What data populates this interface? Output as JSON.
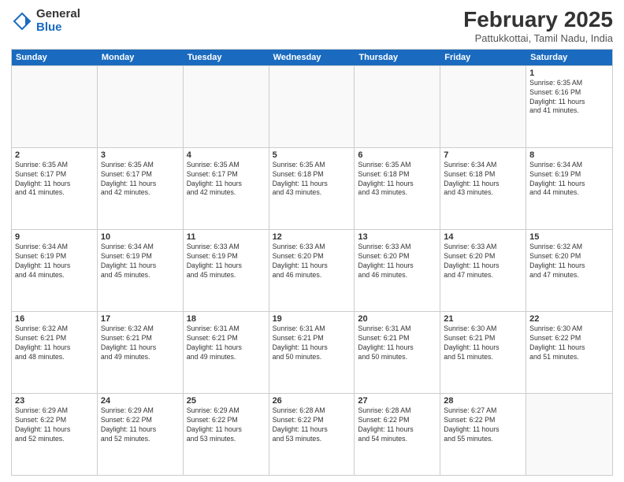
{
  "logo": {
    "general": "General",
    "blue": "Blue"
  },
  "title": "February 2025",
  "subtitle": "Pattukkottai, Tamil Nadu, India",
  "days": [
    "Sunday",
    "Monday",
    "Tuesday",
    "Wednesday",
    "Thursday",
    "Friday",
    "Saturday"
  ],
  "weeks": [
    [
      {
        "day": "",
        "info": ""
      },
      {
        "day": "",
        "info": ""
      },
      {
        "day": "",
        "info": ""
      },
      {
        "day": "",
        "info": ""
      },
      {
        "day": "",
        "info": ""
      },
      {
        "day": "",
        "info": ""
      },
      {
        "day": "1",
        "info": "Sunrise: 6:35 AM\nSunset: 6:16 PM\nDaylight: 11 hours\nand 41 minutes."
      }
    ],
    [
      {
        "day": "2",
        "info": "Sunrise: 6:35 AM\nSunset: 6:17 PM\nDaylight: 11 hours\nand 41 minutes."
      },
      {
        "day": "3",
        "info": "Sunrise: 6:35 AM\nSunset: 6:17 PM\nDaylight: 11 hours\nand 42 minutes."
      },
      {
        "day": "4",
        "info": "Sunrise: 6:35 AM\nSunset: 6:17 PM\nDaylight: 11 hours\nand 42 minutes."
      },
      {
        "day": "5",
        "info": "Sunrise: 6:35 AM\nSunset: 6:18 PM\nDaylight: 11 hours\nand 43 minutes."
      },
      {
        "day": "6",
        "info": "Sunrise: 6:35 AM\nSunset: 6:18 PM\nDaylight: 11 hours\nand 43 minutes."
      },
      {
        "day": "7",
        "info": "Sunrise: 6:34 AM\nSunset: 6:18 PM\nDaylight: 11 hours\nand 43 minutes."
      },
      {
        "day": "8",
        "info": "Sunrise: 6:34 AM\nSunset: 6:19 PM\nDaylight: 11 hours\nand 44 minutes."
      }
    ],
    [
      {
        "day": "9",
        "info": "Sunrise: 6:34 AM\nSunset: 6:19 PM\nDaylight: 11 hours\nand 44 minutes."
      },
      {
        "day": "10",
        "info": "Sunrise: 6:34 AM\nSunset: 6:19 PM\nDaylight: 11 hours\nand 45 minutes."
      },
      {
        "day": "11",
        "info": "Sunrise: 6:33 AM\nSunset: 6:19 PM\nDaylight: 11 hours\nand 45 minutes."
      },
      {
        "day": "12",
        "info": "Sunrise: 6:33 AM\nSunset: 6:20 PM\nDaylight: 11 hours\nand 46 minutes."
      },
      {
        "day": "13",
        "info": "Sunrise: 6:33 AM\nSunset: 6:20 PM\nDaylight: 11 hours\nand 46 minutes."
      },
      {
        "day": "14",
        "info": "Sunrise: 6:33 AM\nSunset: 6:20 PM\nDaylight: 11 hours\nand 47 minutes."
      },
      {
        "day": "15",
        "info": "Sunrise: 6:32 AM\nSunset: 6:20 PM\nDaylight: 11 hours\nand 47 minutes."
      }
    ],
    [
      {
        "day": "16",
        "info": "Sunrise: 6:32 AM\nSunset: 6:21 PM\nDaylight: 11 hours\nand 48 minutes."
      },
      {
        "day": "17",
        "info": "Sunrise: 6:32 AM\nSunset: 6:21 PM\nDaylight: 11 hours\nand 49 minutes."
      },
      {
        "day": "18",
        "info": "Sunrise: 6:31 AM\nSunset: 6:21 PM\nDaylight: 11 hours\nand 49 minutes."
      },
      {
        "day": "19",
        "info": "Sunrise: 6:31 AM\nSunset: 6:21 PM\nDaylight: 11 hours\nand 50 minutes."
      },
      {
        "day": "20",
        "info": "Sunrise: 6:31 AM\nSunset: 6:21 PM\nDaylight: 11 hours\nand 50 minutes."
      },
      {
        "day": "21",
        "info": "Sunrise: 6:30 AM\nSunset: 6:21 PM\nDaylight: 11 hours\nand 51 minutes."
      },
      {
        "day": "22",
        "info": "Sunrise: 6:30 AM\nSunset: 6:22 PM\nDaylight: 11 hours\nand 51 minutes."
      }
    ],
    [
      {
        "day": "23",
        "info": "Sunrise: 6:29 AM\nSunset: 6:22 PM\nDaylight: 11 hours\nand 52 minutes."
      },
      {
        "day": "24",
        "info": "Sunrise: 6:29 AM\nSunset: 6:22 PM\nDaylight: 11 hours\nand 52 minutes."
      },
      {
        "day": "25",
        "info": "Sunrise: 6:29 AM\nSunset: 6:22 PM\nDaylight: 11 hours\nand 53 minutes."
      },
      {
        "day": "26",
        "info": "Sunrise: 6:28 AM\nSunset: 6:22 PM\nDaylight: 11 hours\nand 53 minutes."
      },
      {
        "day": "27",
        "info": "Sunrise: 6:28 AM\nSunset: 6:22 PM\nDaylight: 11 hours\nand 54 minutes."
      },
      {
        "day": "28",
        "info": "Sunrise: 6:27 AM\nSunset: 6:22 PM\nDaylight: 11 hours\nand 55 minutes."
      },
      {
        "day": "",
        "info": ""
      }
    ]
  ]
}
